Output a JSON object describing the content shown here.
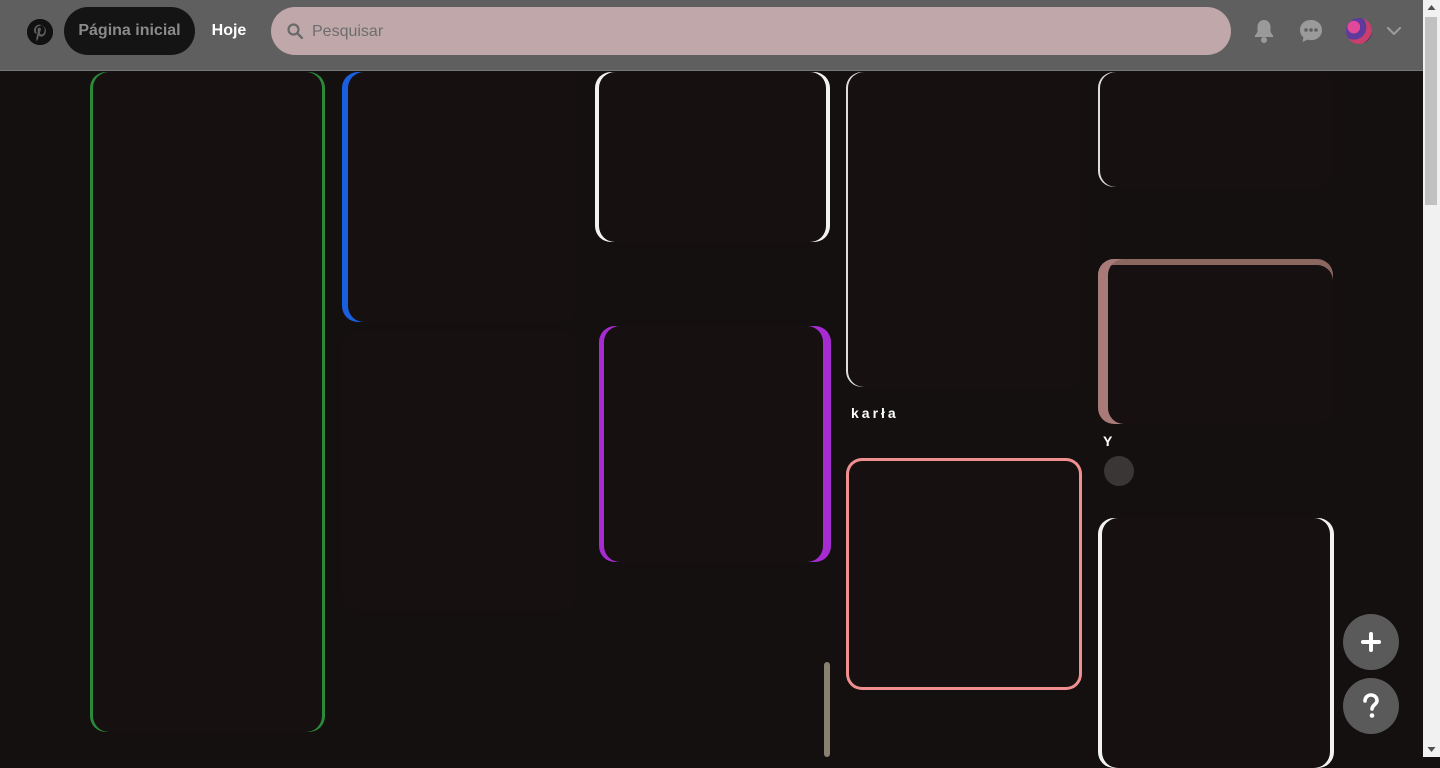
{
  "header": {
    "nav_home": "Página inicial",
    "nav_today": "Hoje",
    "search_placeholder": "Pesquisar"
  },
  "pins": {
    "karla_title": "karła",
    "partial_title": "Y"
  },
  "colors": {
    "header_bg": "#5f5f5f",
    "feed_bg": "#141010",
    "search_bg": "#c0a8aa",
    "accent_purple": "#a62bd0",
    "accent_pink": "#f08f90"
  }
}
